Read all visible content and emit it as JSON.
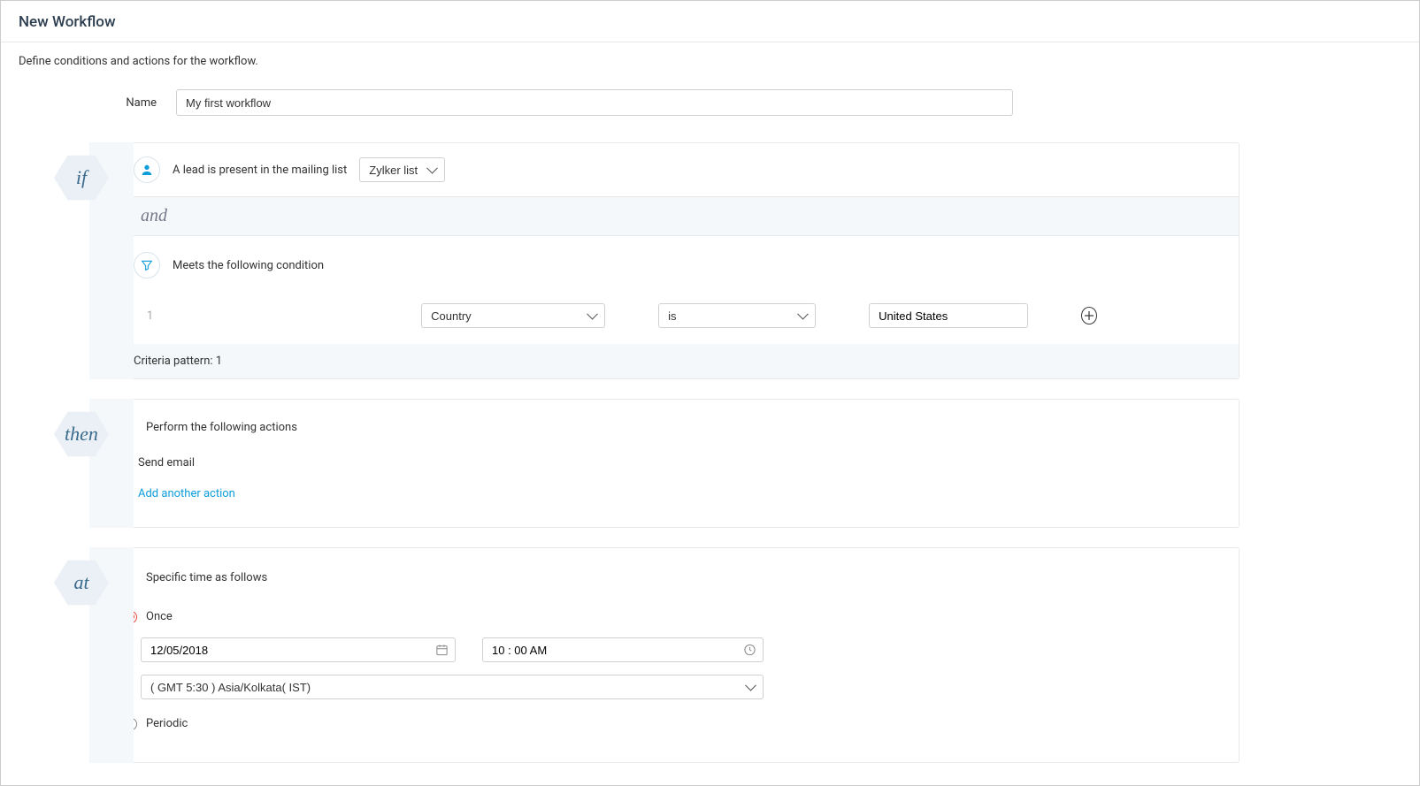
{
  "page_title": "New Workflow",
  "sub_desc": "Define conditions and actions for the workflow.",
  "name_label": "Name",
  "name_value": "My first workflow",
  "if_label": "if",
  "and_label": "and",
  "then_label": "then",
  "at_label": "at",
  "if": {
    "lead_text": "A lead is present in the mailing list",
    "mailing_list": "Zylker list",
    "cond_heading": "Meets the following condition",
    "conditions": [
      {
        "idx": "1",
        "field": "Country",
        "operator": "is",
        "value": "United States"
      }
    ],
    "criteria_pattern": "Criteria pattern: 1"
  },
  "then": {
    "heading": "Perform the following actions",
    "actions": [
      {
        "label": "Send email"
      }
    ],
    "add_link": "Add another action"
  },
  "at": {
    "heading": "Specific time as follows",
    "once_label": "Once",
    "periodic_label": "Periodic",
    "selected": "once",
    "date": "12/05/2018",
    "time": "10 : 00 AM",
    "timezone": "( GMT 5:30 ) Asia/Kolkata( IST)"
  }
}
